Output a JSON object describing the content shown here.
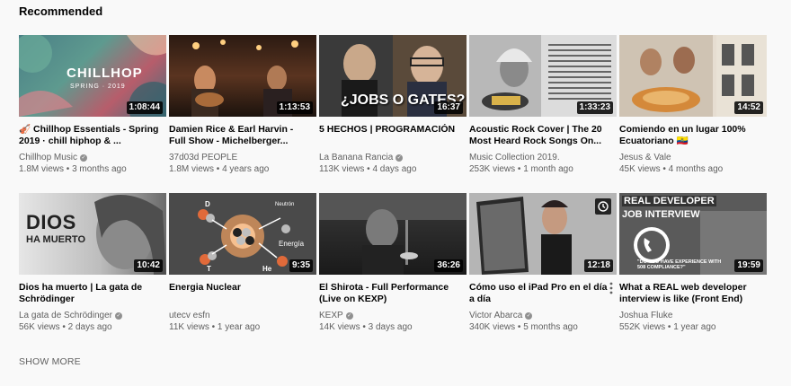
{
  "section": {
    "title": "Recommended"
  },
  "videos": [
    {
      "title": "🎻 Chillhop Essentials - Spring 2019 · chill hiphop & ...",
      "channel": "Chillhop Music",
      "verified": true,
      "views": "1.8M views",
      "age": "3 months ago",
      "duration": "1:08:44",
      "thumb_text": "CHILLHOP",
      "thumb_sub": "SPRING · 2019"
    },
    {
      "title": "Damien Rice & Earl Harvin - Full Show - Michelberger...",
      "channel": "37d03d PEOPLE",
      "verified": false,
      "views": "1.8M views",
      "age": "4 years ago",
      "duration": "1:13:53"
    },
    {
      "title": "5 HECHOS | PROGRAMACIÓN",
      "channel": "La Banana Rancia",
      "verified": true,
      "views": "113K views",
      "age": "4 days ago",
      "duration": "16:37",
      "thumb_text": "¿JOBS O GATES?"
    },
    {
      "title": "Acoustic Rock Cover | The 20 Most Heard Rock Songs On...",
      "channel": "Music Collection 2019.",
      "verified": false,
      "views": "253K views",
      "age": "1 month ago",
      "duration": "1:33:23"
    },
    {
      "title": "Comiendo en un lugar 100% Ecuatoriano 🇪🇨",
      "channel": "Jesus & Vale",
      "verified": false,
      "views": "45K views",
      "age": "4 months ago",
      "duration": "14:52"
    },
    {
      "title": "Dios ha muerto | La gata de Schrödinger",
      "channel": "La gata de Schrödinger",
      "verified": true,
      "views": "56K views",
      "age": "2 days ago",
      "duration": "10:42",
      "thumb_text": "DIOS",
      "thumb_sub": "HA MUERTO"
    },
    {
      "title": "Energia Nuclear",
      "channel": "utecv esfn",
      "verified": false,
      "views": "11K views",
      "age": "1 year ago",
      "duration": "9:35",
      "thumb_labels": [
        "D",
        "Neutrón",
        "Energía",
        "T",
        "He"
      ]
    },
    {
      "title": "El Shirota - Full Performance (Live on KEXP)",
      "channel": "KEXP",
      "verified": true,
      "views": "14K views",
      "age": "3 days ago",
      "duration": "36:26"
    },
    {
      "title": "Cómo uso el iPad Pro en el día a día",
      "channel": "Victor Abarca",
      "verified": true,
      "views": "340K views",
      "age": "5 months ago",
      "duration": "12:18"
    },
    {
      "title": "What a REAL web developer interview is like (Front End)",
      "channel": "Joshua Fluke",
      "verified": false,
      "views": "552K views",
      "age": "1 year ago",
      "duration": "19:59",
      "thumb_text": "REAL DEVELOPER",
      "thumb_sub": "JOB INTERVIEW",
      "thumb_caption": "\"DO YOU HAVE EXPERIENCE WITH 508 COMPLIANCE?\""
    }
  ],
  "show_more_label": "SHOW MORE",
  "colors": {
    "background": "#f9f9f9",
    "secondary_text": "#606060",
    "primary_text": "#030303"
  }
}
